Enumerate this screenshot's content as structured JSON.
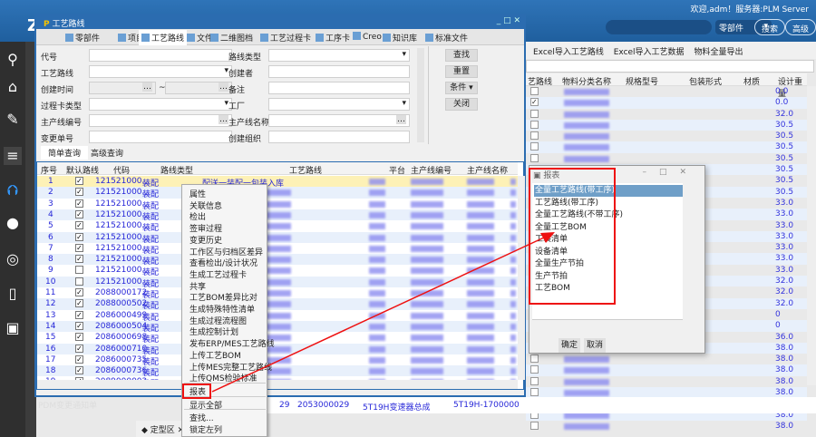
{
  "topbar": {
    "welcome": "欢迎,adm！服务器:PLM Server",
    "search_type": "零部件",
    "search_button": "搜索",
    "advanced_button": "高级"
  },
  "background": {
    "toolbar": [
      "Excel导入工艺路线",
      "Excel导入工艺数据",
      "物料全量导出"
    ],
    "columns": [
      "艺路线",
      "物料分类名称",
      "规格型号",
      "包装形式",
      "材质",
      "设计重量"
    ],
    "checked": [
      false,
      true,
      false,
      false,
      false,
      false,
      false,
      false,
      false,
      false,
      false,
      false,
      false,
      false,
      false,
      false,
      false,
      false,
      false,
      false,
      false,
      false,
      false,
      false,
      false,
      false,
      false,
      false,
      false,
      false,
      false
    ],
    "weights": [
      "0.0",
      "0.0",
      "32.0",
      "30.5",
      "30.5",
      "30.5",
      "30.5",
      "30.5",
      "30.5",
      "30.5",
      "33.0",
      "33.0",
      "33.0",
      "33.0",
      "33.0",
      "33.0",
      "33.0",
      "32.0",
      "32.0",
      "32.0",
      "0",
      "0",
      "36.0",
      "38.0",
      "38.0",
      "38.0",
      "38.0",
      "38.0",
      "38.0",
      "38.0",
      "38.0"
    ],
    "row29": {
      "no": "29",
      "code": "2053000029",
      "name": "5T19H变速器总成",
      "line": "5T19H-1700000"
    }
  },
  "window": {
    "title": "工艺路线",
    "tabs": [
      "零部件",
      "项目",
      "工艺路线",
      "文件",
      "二维图档",
      "工艺过程卡",
      "工序卡",
      "Creo",
      "知识库",
      "标准文件"
    ],
    "form": {
      "code": "代号",
      "route": "工艺路线",
      "created_time": "创建时间",
      "card_type": "过程卡类型",
      "line_no": "主产线编号",
      "change_no": "变更单号",
      "route_type": "路线类型",
      "creator": "创建者",
      "remark": "备注",
      "factory": "工厂",
      "line_name": "主产线名称",
      "org": "创建组织",
      "tilde": "~"
    },
    "buttons": {
      "search": "查找",
      "reset": "重置",
      "condition": "条件 ▾",
      "close": "关闭"
    },
    "query_tabs": [
      "简单查询",
      "高级查询"
    ],
    "columns": [
      "序号",
      "默认路线",
      "代码",
      "路线类型",
      "工艺路线",
      "平台",
      "主产线编号",
      "主产线名称"
    ],
    "rows": [
      {
        "no": "1",
        "checked": true,
        "code": "121521000...",
        "type": "装配",
        "route": "配送一装配一包装入库"
      },
      {
        "no": "2",
        "checked": true,
        "code": "121521000...",
        "type": "装配"
      },
      {
        "no": "3",
        "checked": true,
        "code": "121521000...",
        "type": "装配"
      },
      {
        "no": "4",
        "checked": true,
        "code": "121521000...",
        "type": "装配"
      },
      {
        "no": "5",
        "checked": true,
        "code": "121521000...",
        "type": "装配"
      },
      {
        "no": "6",
        "checked": true,
        "code": "121521000...",
        "type": "装配"
      },
      {
        "no": "7",
        "checked": true,
        "code": "121521000...",
        "type": "装配"
      },
      {
        "no": "8",
        "checked": true,
        "code": "121521000...",
        "type": "装配"
      },
      {
        "no": "9",
        "checked": false,
        "code": "121521000...",
        "type": "装配"
      },
      {
        "no": "10",
        "checked": false,
        "code": "121521000...",
        "type": "装配"
      },
      {
        "no": "11",
        "checked": true,
        "code": "2088000172",
        "type": "装配"
      },
      {
        "no": "12",
        "checked": true,
        "code": "2088000502",
        "type": "装配"
      },
      {
        "no": "13",
        "checked": true,
        "code": "2086000499",
        "type": "装配"
      },
      {
        "no": "14",
        "checked": true,
        "code": "2086000504",
        "type": "装配"
      },
      {
        "no": "15",
        "checked": true,
        "code": "2086000698",
        "type": "装配"
      },
      {
        "no": "16",
        "checked": true,
        "code": "2086000710",
        "type": "装配"
      },
      {
        "no": "17",
        "checked": true,
        "code": "2086000735",
        "type": "装配"
      },
      {
        "no": "18",
        "checked": true,
        "code": "2086000736",
        "type": "装配"
      },
      {
        "no": "19",
        "checked": true,
        "code": "2089000002",
        "type": "装配"
      }
    ]
  },
  "context_menu": [
    "属性",
    "关联信息",
    "检出",
    "签审过程",
    "变更历史",
    "工作区与归档区差异",
    "查看检出/设计状况",
    "生成工艺过程卡",
    "共享",
    "工艺BOM差异比对",
    "生成特殊特性清单",
    "生成过程流程图",
    "生成控制计划",
    "发布ERP/MES工艺路线",
    "上传工艺BOM",
    "上传MES完整工艺路线",
    "上传QMS检验标准",
    "报表",
    "显示全部",
    "查找...",
    "锁定左列"
  ],
  "dialog": {
    "title": "报表",
    "items": [
      "全量工艺路线(带工序)",
      "工艺路线(带工序)",
      "全量工艺路线(不带工序)",
      "全量工艺BOM",
      "工装清单",
      "设备清单",
      "全量生产节拍",
      "生产节拍",
      "工艺BOM"
    ],
    "selected": 0,
    "ok": "确定",
    "cancel": "取消"
  },
  "status": {
    "notice": "PDM变更通知单",
    "tab": "定型区"
  }
}
